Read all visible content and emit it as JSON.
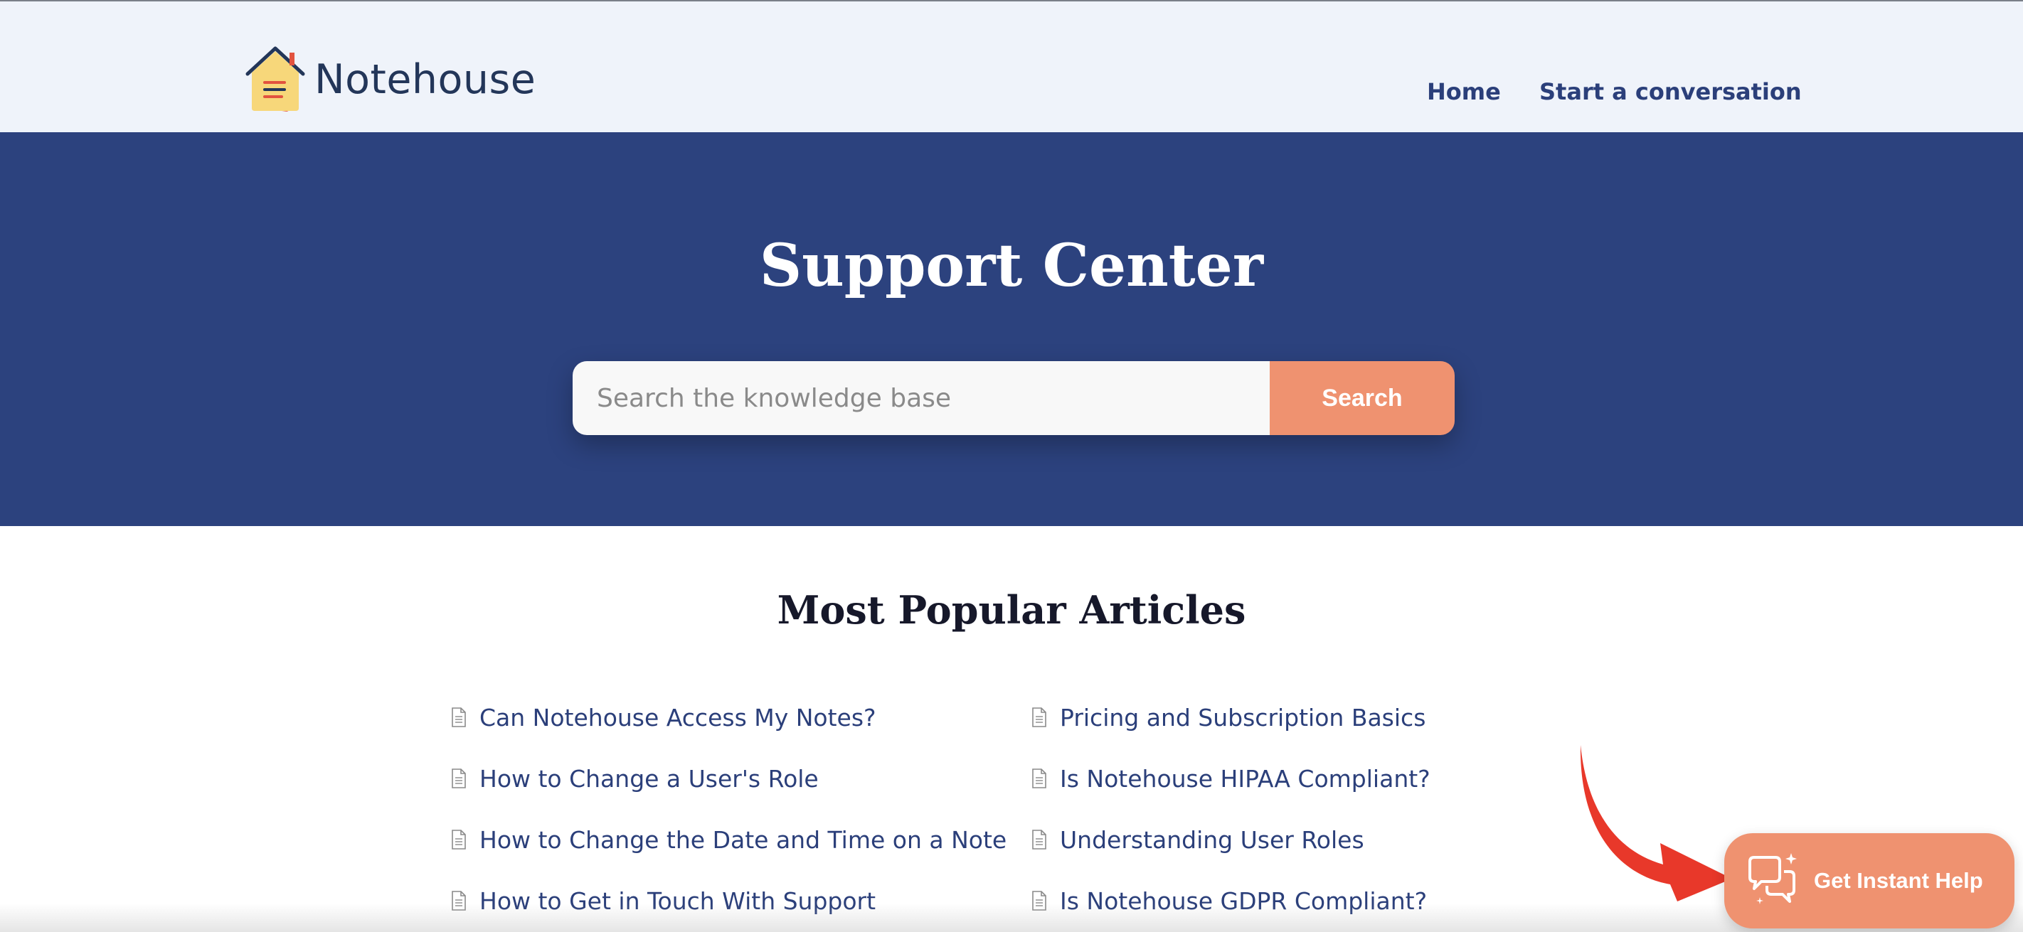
{
  "header": {
    "brand": "Notehouse",
    "nav": [
      {
        "label": "Home"
      },
      {
        "label": "Start a conversation"
      }
    ]
  },
  "hero": {
    "title": "Support Center",
    "search": {
      "placeholder": "Search the knowledge base",
      "value": "",
      "button_label": "Search"
    }
  },
  "articles": {
    "title": "Most Popular Articles",
    "left": [
      "Can Notehouse Access My Notes?",
      "How to Change a User's Role",
      "How to Change the Date and Time on a Note",
      "How to Get in Touch With Support"
    ],
    "right": [
      "Pricing and Subscription Basics",
      "Is Notehouse HIPAA Compliant?",
      "Understanding User Roles",
      "Is Notehouse GDPR Compliant?"
    ],
    "item_icon": "document-icon"
  },
  "help_widget": {
    "label": "Get Instant Help",
    "icon": "chat-sparkle-icon"
  },
  "colors": {
    "header_bg": "#eff3fa",
    "hero_bg": "#2c427e",
    "accent": "#ef9270",
    "link": "#2b3f7a",
    "arrow": "#e8382a"
  }
}
